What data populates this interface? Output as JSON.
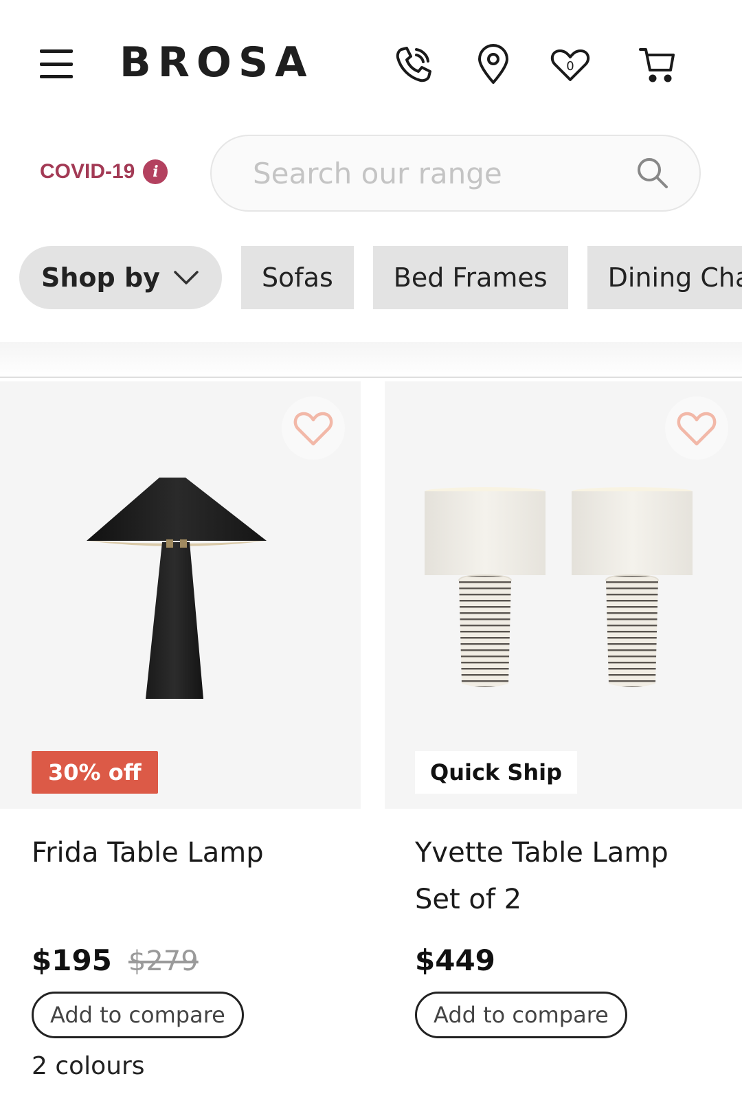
{
  "header": {
    "logo": "BROSA",
    "icons": [
      "menu-icon",
      "phone-icon",
      "location-pin-icon",
      "wishlist-heart-icon",
      "cart-icon"
    ],
    "wishlist_count": "0"
  },
  "notice": {
    "label": "COVID-19",
    "info_glyph": "i"
  },
  "search": {
    "placeholder": "Search our range",
    "value": ""
  },
  "chips": {
    "shop_by": "Shop by",
    "items": [
      "Sofas",
      "Bed Frames",
      "Dining Chair"
    ]
  },
  "products": [
    {
      "name_lines": [
        "Frida Table Lamp"
      ],
      "badge": "30% off",
      "price": "$195",
      "old_price": "$279",
      "compare": "Add to compare",
      "colours": "2 colours"
    },
    {
      "name_lines": [
        "Yvette Table Lamp",
        "Set of 2"
      ],
      "badge": "Quick Ship",
      "price": "$449",
      "old_price": "",
      "compare": "Add to compare",
      "colours": ""
    }
  ],
  "colors": {
    "accent_covid": "#b3415f",
    "sale_badge": "#dc5a47",
    "heart_outline": "#f2b8a8"
  }
}
